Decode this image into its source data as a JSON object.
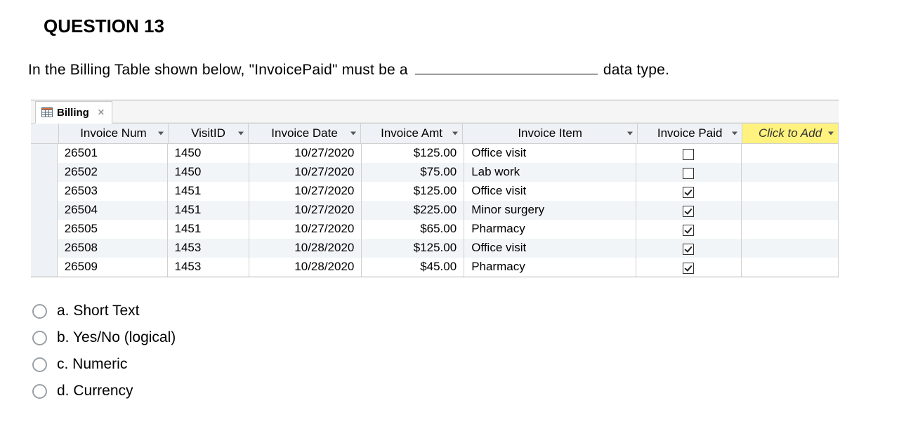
{
  "question_title": "QUESTION 13",
  "prompt_before": "In the Billing Table shown below, \"InvoicePaid\" must be a ",
  "prompt_after": " data type.",
  "tab_label": "Billing",
  "columns": {
    "invoice_num": "Invoice Num",
    "visit_id": "VisitID",
    "invoice_date": "Invoice Date",
    "invoice_amt": "Invoice Amt",
    "invoice_item": "Invoice Item",
    "invoice_paid": "Invoice Paid",
    "add_col": "Click to Add"
  },
  "chart_data": {
    "type": "table",
    "columns": [
      "Invoice Num",
      "VisitID",
      "Invoice Date",
      "Invoice Amt",
      "Invoice Item",
      "Invoice Paid"
    ],
    "rows": [
      {
        "invoice_num": "26501",
        "visit_id": "1450",
        "invoice_date": "10/27/2020",
        "invoice_amt": "$125.00",
        "invoice_item": "Office visit",
        "invoice_paid": false
      },
      {
        "invoice_num": "26502",
        "visit_id": "1450",
        "invoice_date": "10/27/2020",
        "invoice_amt": "$75.00",
        "invoice_item": "Lab work",
        "invoice_paid": false
      },
      {
        "invoice_num": "26503",
        "visit_id": "1451",
        "invoice_date": "10/27/2020",
        "invoice_amt": "$125.00",
        "invoice_item": "Office visit",
        "invoice_paid": true
      },
      {
        "invoice_num": "26504",
        "visit_id": "1451",
        "invoice_date": "10/27/2020",
        "invoice_amt": "$225.00",
        "invoice_item": "Minor surgery",
        "invoice_paid": true
      },
      {
        "invoice_num": "26505",
        "visit_id": "1451",
        "invoice_date": "10/27/2020",
        "invoice_amt": "$65.00",
        "invoice_item": "Pharmacy",
        "invoice_paid": true
      },
      {
        "invoice_num": "26508",
        "visit_id": "1453",
        "invoice_date": "10/28/2020",
        "invoice_amt": "$125.00",
        "invoice_item": "Office visit",
        "invoice_paid": true
      },
      {
        "invoice_num": "26509",
        "visit_id": "1453",
        "invoice_date": "10/28/2020",
        "invoice_amt": "$45.00",
        "invoice_item": "Pharmacy",
        "invoice_paid": true
      }
    ]
  },
  "options": {
    "a": "a. Short Text",
    "b": "b. Yes/No (logical)",
    "c": "c. Numeric",
    "d": "d. Currency"
  }
}
